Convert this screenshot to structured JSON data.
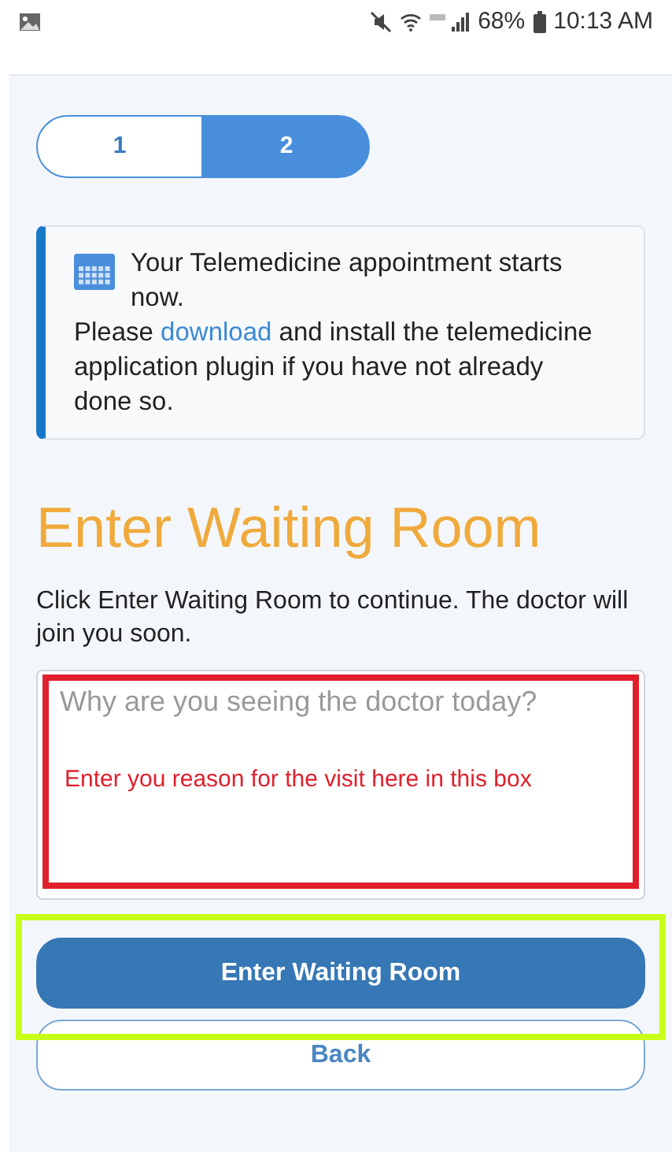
{
  "status_bar": {
    "battery": "68%",
    "time": "10:13 AM"
  },
  "steps": [
    {
      "label": "1",
      "selected": false
    },
    {
      "label": "2",
      "selected": true
    }
  ],
  "notice": {
    "title": "Your Telemedicine appointment starts now.",
    "before_link": "Please",
    "link": "download",
    "after_link": "and install the telemedicine application plugin if you have not already done so."
  },
  "heading": "Enter Waiting Room",
  "instructions": "Click Enter Waiting Room to continue. The doctor will join you soon.",
  "reason_field": {
    "placeholder": "Why are you seeing the doctor today?"
  },
  "buttons": [
    {
      "label": "Enter Waiting Room",
      "kind": "primary"
    },
    {
      "label": "Back",
      "kind": "outline"
    }
  ],
  "annotations": [
    {
      "kind": "field",
      "color": "#e0202c",
      "text": "Enter you reason for the visit here in this box"
    },
    {
      "kind": "button",
      "color": "#c8ff1a"
    }
  ]
}
